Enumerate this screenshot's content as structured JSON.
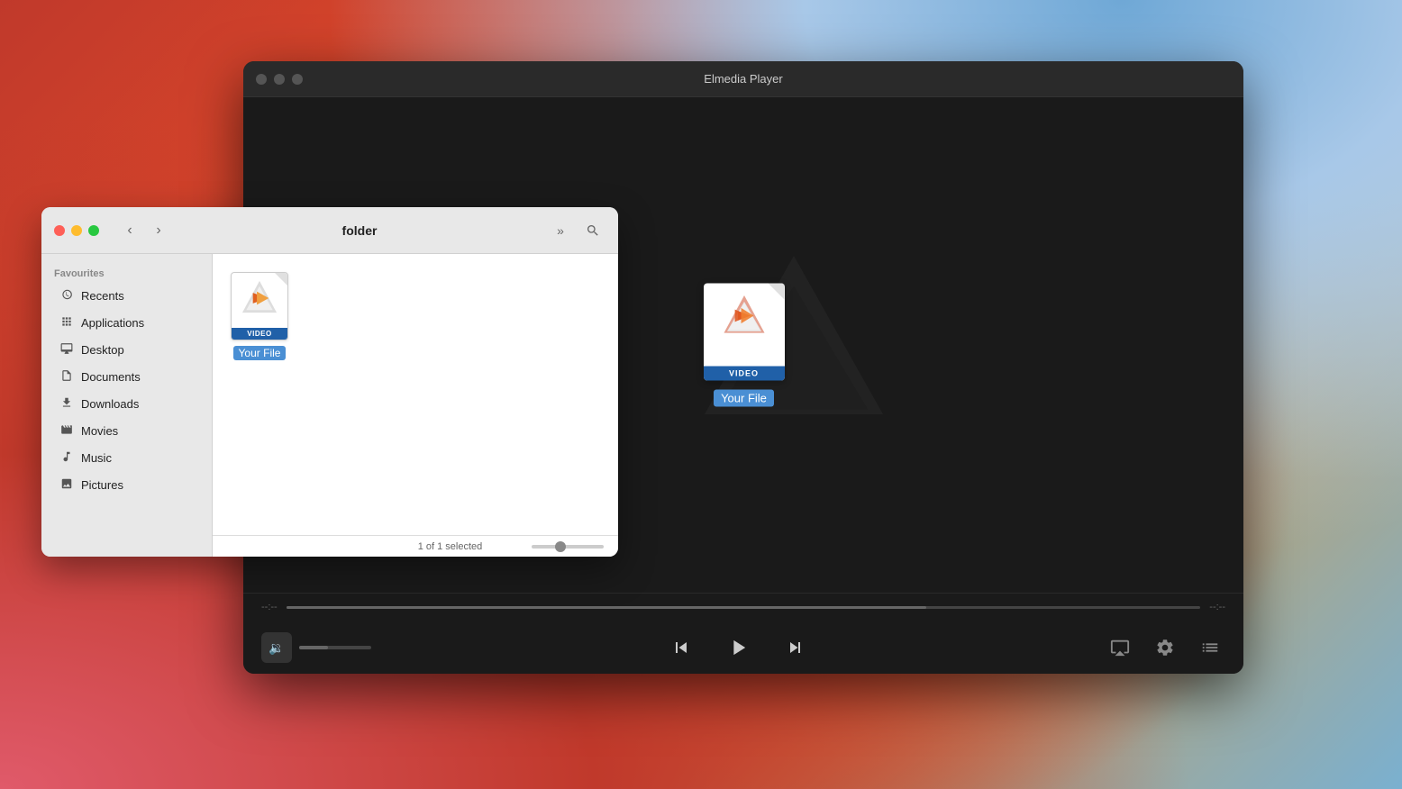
{
  "desktop": {
    "bg_colors": [
      "#c0392b",
      "#e04a2a",
      "#7ab0d0"
    ]
  },
  "player_window": {
    "title": "Elmedia Player",
    "traffic_lights": {
      "close_color": "#555555",
      "min_color": "#555555",
      "max_color": "#555555"
    },
    "file_label": "Your File",
    "time_start": "--:--",
    "time_end": "--:--",
    "controls": {
      "skip_back_label": "⏮",
      "play_label": "▶",
      "skip_forward_label": "⏭",
      "airplay_label": "⊙",
      "settings_label": "⚙",
      "playlist_label": "☰"
    }
  },
  "finder_window": {
    "title": "folder",
    "traffic_lights": {
      "close_color": "#fe5f57",
      "min_color": "#febc2e",
      "max_color": "#28c840"
    },
    "sidebar": {
      "section_title": "Favourites",
      "items": [
        {
          "id": "recents",
          "icon": "🕐",
          "label": "Recents"
        },
        {
          "id": "applications",
          "icon": "⬛",
          "label": "Applications"
        },
        {
          "id": "desktop",
          "icon": "🖥",
          "label": "Desktop"
        },
        {
          "id": "documents",
          "icon": "📄",
          "label": "Documents"
        },
        {
          "id": "downloads",
          "icon": "⬇",
          "label": "Downloads"
        },
        {
          "id": "movies",
          "icon": "🎞",
          "label": "Movies"
        },
        {
          "id": "music",
          "icon": "♪",
          "label": "Music"
        },
        {
          "id": "pictures",
          "icon": "🖼",
          "label": "Pictures"
        }
      ]
    },
    "file": {
      "name": "Your File",
      "type_label": "VIDEO"
    },
    "status": "1 of 1 selected",
    "nav": {
      "back_label": "‹",
      "forward_label": "›",
      "more_label": "»",
      "search_label": "🔍"
    }
  }
}
